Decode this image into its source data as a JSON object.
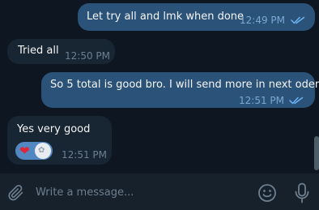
{
  "messages": [
    {
      "direction": "outgoing",
      "text": "Let try all and lmk when done",
      "time": "12:49 PM",
      "status": "read"
    },
    {
      "direction": "incoming",
      "text": "Tried all",
      "time": "12:50 PM"
    },
    {
      "direction": "outgoing",
      "text": "So 5 total is good bro. I will send more in next oder",
      "time": "12:51 PM",
      "status": "read"
    },
    {
      "direction": "incoming",
      "text": "Yes very good",
      "time": "12:51 PM",
      "reaction": {
        "emoji": "❤",
        "icon": "reactor-avatar-icon"
      }
    }
  ],
  "composer": {
    "placeholder": "Write a message..."
  },
  "colors": {
    "background": "#0e1621",
    "outgoing_bubble": "#2b5278",
    "incoming_bubble": "#182533",
    "composer": "#17212b",
    "read_checks": "#6ab3f3",
    "reaction_pill": "#5288c1"
  }
}
